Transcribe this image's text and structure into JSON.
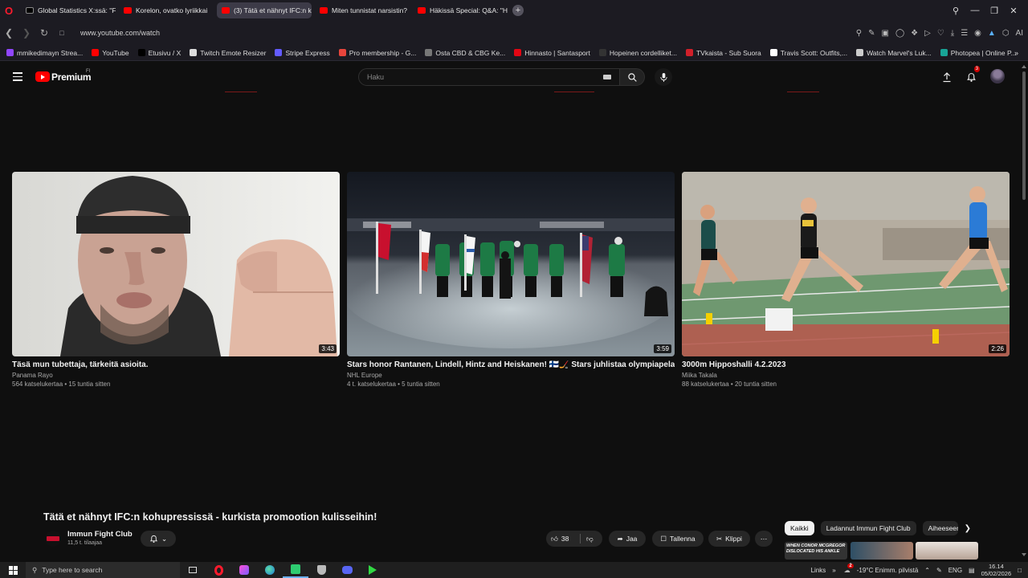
{
  "browser": {
    "tabs": [
      {
        "label": "Global Statistics X:ssä: \"Fo",
        "fav_color": "#000000",
        "sep_color": "",
        "active": false,
        "icon": "x-logo-icon"
      },
      {
        "label": "Korelon, ovatko lyriikkai",
        "fav_color": "#ff0000",
        "sep_color": "#c0158c",
        "active": false,
        "icon": "youtube-icon"
      },
      {
        "label": "(3) Tätä et nähnyt IFC:n k",
        "fav_color": "#ff0000",
        "sep_color": "#c0158c",
        "active": true,
        "icon": "youtube-icon"
      },
      {
        "label": "Miten tunnistat narsistin?",
        "fav_color": "#ff0000",
        "sep_color": "#7b2fd9",
        "active": false,
        "icon": "youtube-icon"
      },
      {
        "label": "Häkissä Special: Q&A: \"Hä",
        "fav_color": "#ff0000",
        "sep_color": "",
        "active": false,
        "icon": "youtube-icon"
      }
    ],
    "url": "www.youtube.com/watch",
    "bookmarks": [
      {
        "label": "mmikedimayn Strea...",
        "color": "#9146ff"
      },
      {
        "label": "YouTube",
        "color": "#ff0000"
      },
      {
        "label": "Etusivu / X",
        "color": "#000000"
      },
      {
        "label": "Twitch Emote Resizer",
        "color": "#dddddd"
      },
      {
        "label": "Stripe Express",
        "color": "#635bff"
      },
      {
        "label": "Pro membership - G...",
        "color": "#e8453c"
      },
      {
        "label": "Osta CBD & CBG Ke...",
        "color": "#777777"
      },
      {
        "label": "Hinnasto | Santasport",
        "color": "#e30613"
      },
      {
        "label": "Hopeinen cordelliket...",
        "color": "#333333"
      },
      {
        "label": "TVkaista - Sub Suora",
        "color": "#d1202a"
      },
      {
        "label": "Travis Scott: Outfits,...",
        "color": "#ffffff"
      },
      {
        "label": "Watch Marvel's Luk...",
        "color": "#cccccc"
      },
      {
        "label": "Photopea | Online P...",
        "color": "#18a497"
      }
    ],
    "ai_label": "AI"
  },
  "youtube": {
    "brand": "Premium",
    "country": "FI",
    "search_placeholder": "Haku",
    "notification_count": "3",
    "videos": [
      {
        "title": "Täsä mun tubettaja, tärkeitä asioita.",
        "channel": "Panama Rayo",
        "meta": "564 katselukertaa • 15 tuntia sitten",
        "duration": "3:43"
      },
      {
        "title": "Stars honor Rantanen, Lindell, Hintz and Heiskanen! 🇫🇮🏒 Stars juhlistaa olympiapelaajiaan",
        "channel": "NHL Europe",
        "meta": "4 t. katselukertaa • 5 tuntia sitten",
        "duration": "3:59"
      },
      {
        "title": "3000m Hipposhalli 4.2.2023",
        "channel": "Miika Takala",
        "meta": "88 katselukertaa • 20 tuntia sitten",
        "duration": "2:26"
      }
    ],
    "watch": {
      "title": "Tätä et nähnyt IFC:n kohupressissä - kurkista promootion kulisseihin!",
      "channel_name": "Immun Fight Club",
      "subscribers": "11,5 t. tilaajaa",
      "like_count": "38",
      "share_label": "Jaa",
      "save_label": "Tallenna",
      "clip_label": "Klippi"
    },
    "chips": [
      "Kaikki",
      "Ladannut Immun Fight Club",
      "Aiheeseen"
    ],
    "mini_thumb_text": "When Conor McGregor DISLOCATED His Ankle"
  },
  "taskbar": {
    "search_placeholder": "Type here to search",
    "links_label": "Links",
    "weather": "-19°C  Enimm. pilvistä",
    "lang": "ENG",
    "time": "16.14",
    "date": "05/02/2026",
    "tray_badge": "2"
  }
}
